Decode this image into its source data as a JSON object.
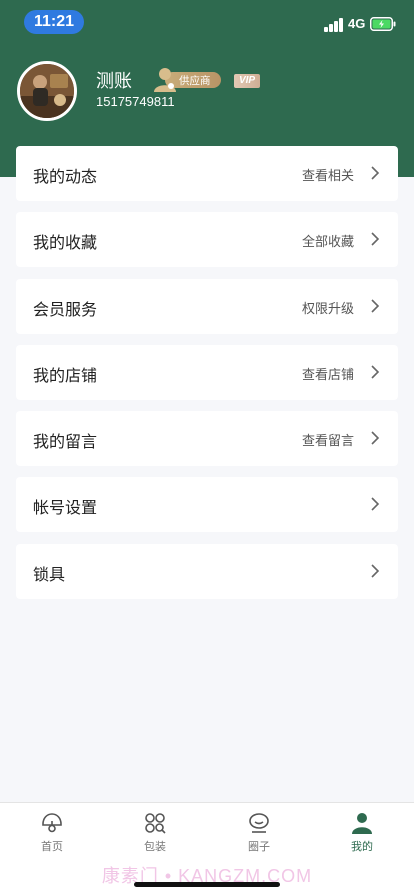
{
  "status_bar": {
    "time": "11:21",
    "network": "4G"
  },
  "profile": {
    "name": "测账",
    "phone": "15175749811",
    "supplier_badge": "供应商",
    "vip_badge": "VIP"
  },
  "menu": [
    {
      "label": "我的动态",
      "hint": "查看相关"
    },
    {
      "label": "我的收藏",
      "hint": "全部收藏"
    },
    {
      "label": "会员服务",
      "hint": "权限升级"
    },
    {
      "label": "我的店铺",
      "hint": "查看店铺"
    },
    {
      "label": "我的留言",
      "hint": "查看留言"
    },
    {
      "label": "帐号设置",
      "hint": ""
    },
    {
      "label": "锁具",
      "hint": ""
    }
  ],
  "tabbar": [
    {
      "label": "首页",
      "icon": "home-icon"
    },
    {
      "label": "包装",
      "icon": "grid-icon"
    },
    {
      "label": "圈子",
      "icon": "circle-icon"
    },
    {
      "label": "我的",
      "icon": "user-icon",
      "active": true
    }
  ],
  "watermark": "康素门 • KANGZM.COM",
  "colors": {
    "brand": "#2e6a4f",
    "time_pill": "#2f7ae0",
    "battery": "#4cd964"
  }
}
